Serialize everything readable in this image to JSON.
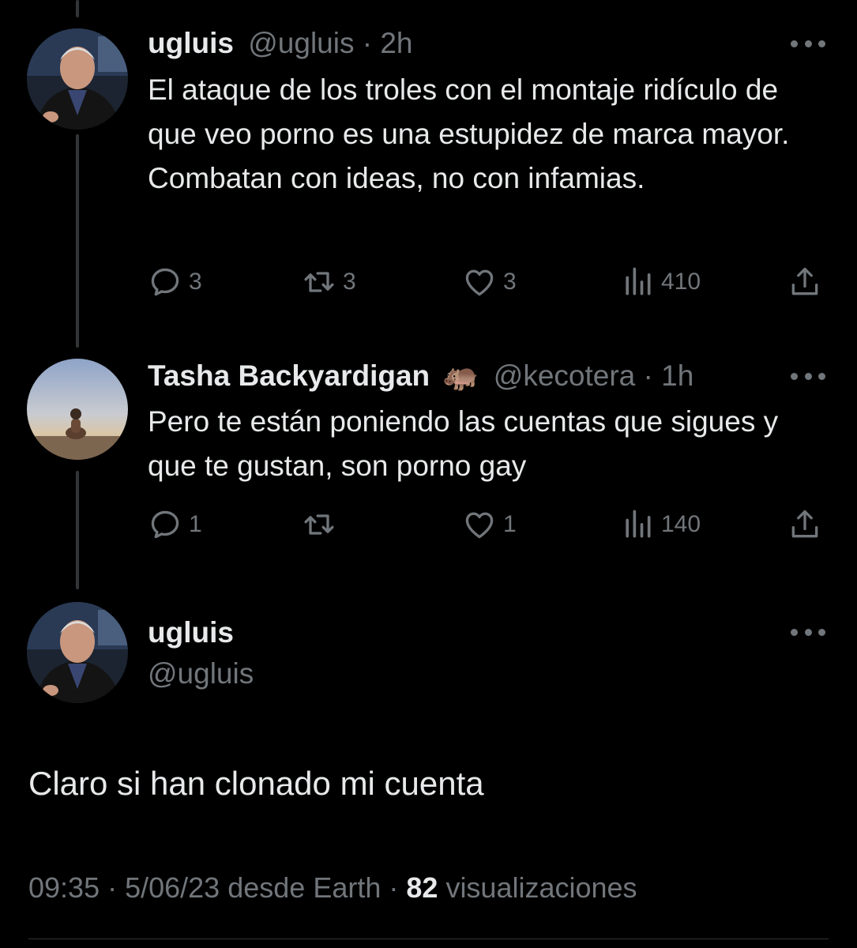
{
  "tweets": [
    {
      "name": "ugluis",
      "handle": "@ugluis",
      "time": "2h",
      "text": "El ataque de los troles con el montaje ridículo de que veo porno es una estupidez de marca mayor. Combatan con ideas, no con infamias.",
      "replies": "3",
      "retweets": "3",
      "likes": "3",
      "views": "410"
    },
    {
      "name": "Tasha Backyardigan",
      "emoji": "🦛",
      "handle": "@kecotera",
      "time": "1h",
      "text": "Pero te están poniendo las cuentas que sigues y que te gustan, son porno gay",
      "replies": "1",
      "retweets": "",
      "likes": "1",
      "views": "140"
    }
  ],
  "main_tweet": {
    "name": "ugluis",
    "handle": "@ugluis",
    "text": "Claro si han clonado mi cuenta",
    "time": "09:35",
    "date": "5/06/23",
    "source": "desde Earth",
    "views_count": "82",
    "views_label": "visualizaciones"
  },
  "icons": {
    "reply": "reply-icon",
    "retweet": "retweet-icon",
    "like": "heart-icon",
    "views": "views-icon",
    "share": "share-icon",
    "more": "more-icon"
  },
  "colors": {
    "background": "#000000",
    "text": "#e7e9ea",
    "secondary": "#71767b",
    "thread_line": "#333639"
  }
}
